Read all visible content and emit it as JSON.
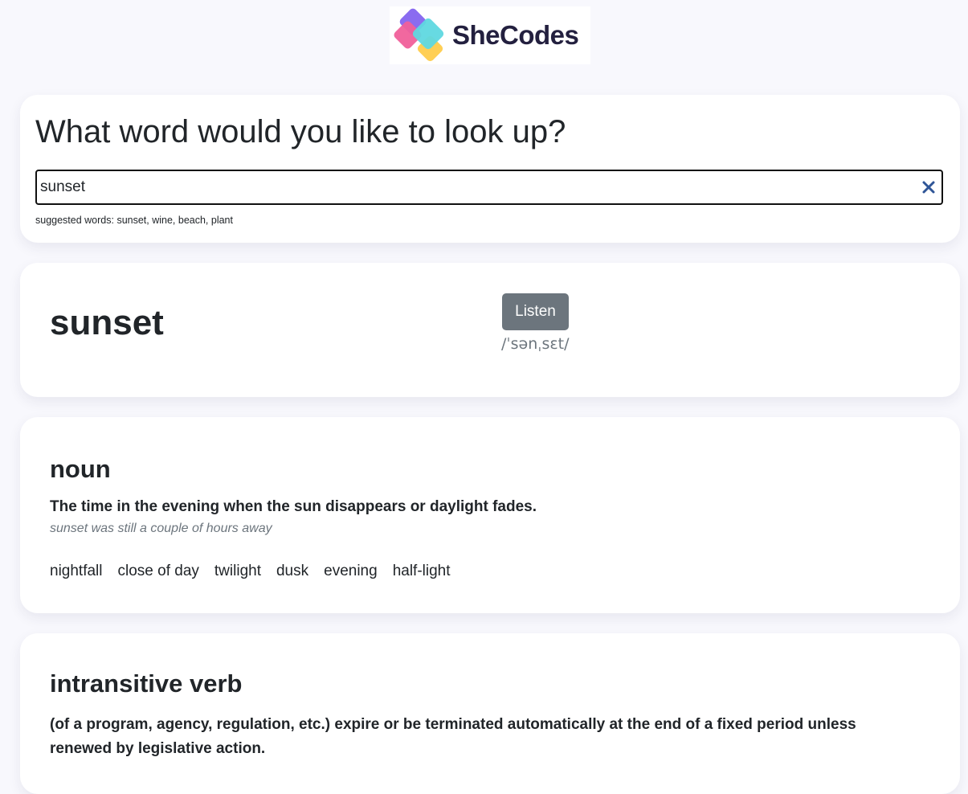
{
  "brand": {
    "name": "SheCodes",
    "colors": {
      "purple": "#8a6cf0",
      "pink": "#f0609a",
      "teal": "#5fd8e0",
      "yellow": "#ffcf55",
      "text": "#23203f"
    }
  },
  "search": {
    "title": "What word would you like to look up?",
    "value": "sunset",
    "clear_icon": "close-icon",
    "suggested": "suggested words: sunset, wine, beach, plant"
  },
  "word": {
    "title": "sunset",
    "listen_label": "Listen",
    "phonetic": "/ˈsənˌsɛt/"
  },
  "meanings": [
    {
      "part_of_speech": "noun",
      "definition": "The time in the evening when the sun disappears or daylight fades.",
      "example": "sunset was still a couple of hours away",
      "synonyms": [
        "nightfall",
        "close of day",
        "twilight",
        "dusk",
        "evening",
        "half-light"
      ]
    },
    {
      "part_of_speech": "intransitive verb",
      "definition": "(of a program, agency, regulation, etc.) expire or be terminated automatically at the end of a fixed period unless renewed by legislative action."
    }
  ]
}
